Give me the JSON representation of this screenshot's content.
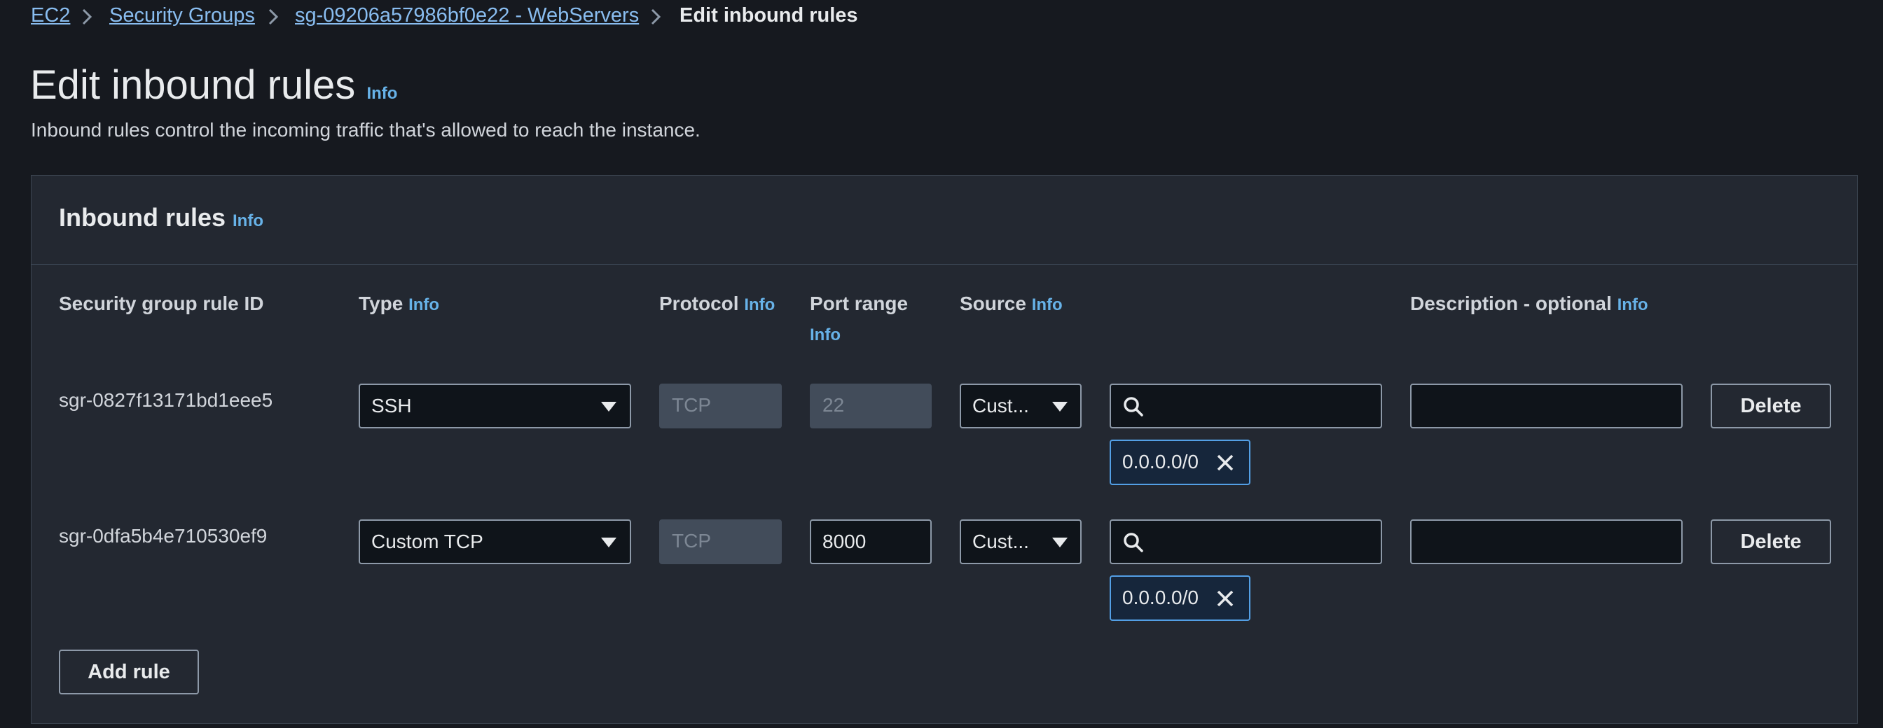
{
  "breadcrumb": {
    "items": [
      "EC2",
      "Security Groups",
      "sg-09206a57986bf0e22 - WebServers"
    ],
    "current": "Edit inbound rules"
  },
  "page": {
    "title": "Edit inbound rules",
    "info": "Info",
    "description": "Inbound rules control the incoming traffic that's allowed to reach the instance."
  },
  "panel": {
    "title": "Inbound rules",
    "info": "Info",
    "columns": {
      "rule_id": "Security group rule ID",
      "type": "Type",
      "protocol": "Protocol",
      "port_range": "Port range",
      "source": "Source",
      "description": "Description - optional",
      "info": "Info"
    },
    "rules": [
      {
        "id": "sgr-0827f13171bd1eee5",
        "type": "SSH",
        "protocol": "TCP",
        "port_range": "22",
        "source": "Cust...",
        "search_value": "",
        "token": "0.0.0.0/0",
        "description": "",
        "delete_label": "Delete"
      },
      {
        "id": "sgr-0dfa5b4e710530ef9",
        "type": "Custom TCP",
        "protocol": "TCP",
        "port_range": "8000",
        "source": "Cust...",
        "search_value": "",
        "token": "0.0.0.0/0",
        "description": "",
        "delete_label": "Delete"
      }
    ],
    "add_rule_label": "Add rule"
  },
  "colors": {
    "background": "#16191f",
    "panel": "#232831",
    "link": "#89bdf0",
    "info": "#67b2e8",
    "token_border": "#539fe5"
  }
}
